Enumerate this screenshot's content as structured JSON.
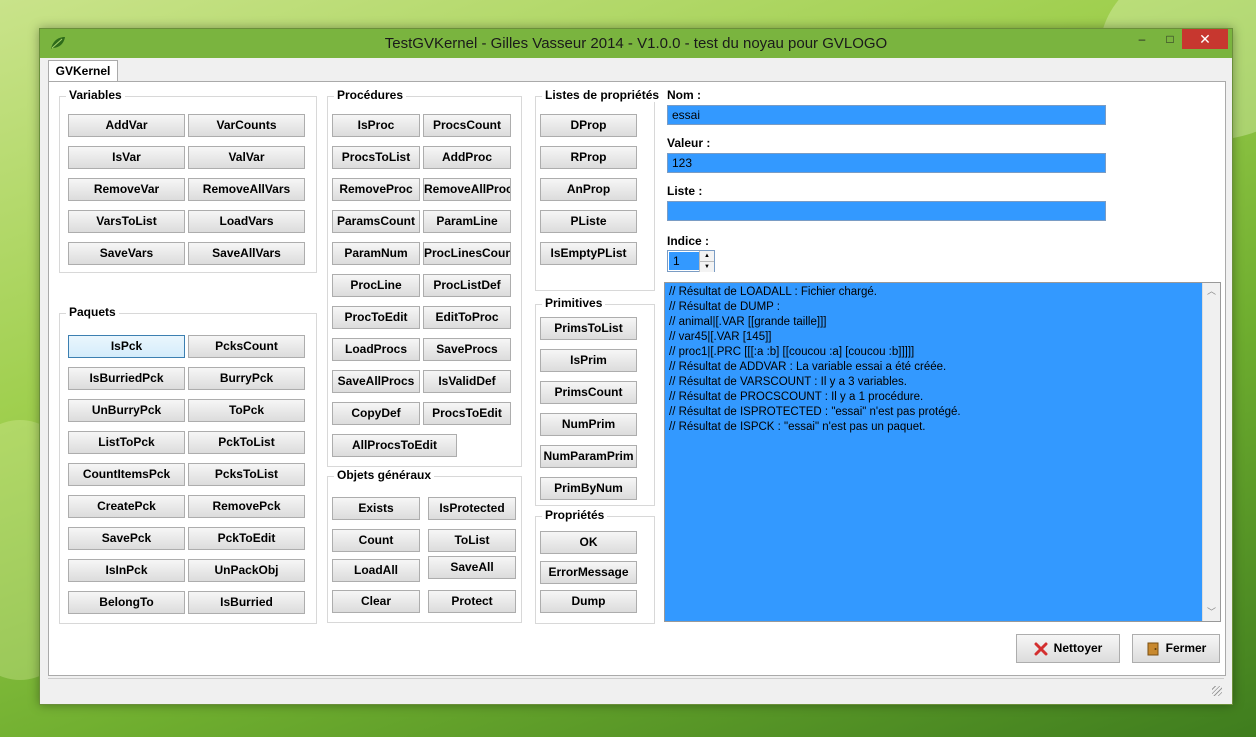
{
  "window": {
    "title": "TestGVKernel - Gilles Vasseur 2014 -  V1.0.0 - test du noyau pour GVLOGO",
    "minimize": "–",
    "maximize": "□",
    "close": "✕"
  },
  "tab": {
    "label": "GVKernel"
  },
  "variables": {
    "title": "Variables",
    "buttons": [
      "AddVar",
      "VarCounts",
      "IsVar",
      "ValVar",
      "RemoveVar",
      "RemoveAllVars",
      "VarsToList",
      "LoadVars",
      "SaveVars",
      "SaveAllVars"
    ]
  },
  "paquets": {
    "title": "Paquets",
    "buttons": [
      "IsPck",
      "PcksCount",
      "IsBurriedPck",
      "BurryPck",
      "UnBurryPck",
      "ToPck",
      "ListToPck",
      "PckToList",
      "CountItemsPck",
      "PcksToList",
      "CreatePck",
      "RemovePck",
      "SavePck",
      "PckToEdit",
      "IsInPck",
      "UnPackObj",
      "BelongTo",
      "IsBurried"
    ]
  },
  "procedures": {
    "title": "Procédures",
    "buttons": [
      "IsProc",
      "ProcsCount",
      "ProcsToList",
      "AddProc",
      "RemoveProc",
      "RemoveAllProcs",
      "ParamsCount",
      "ParamLine",
      "ParamNum",
      "ProcLinesCount",
      "ProcLine",
      "ProcListDef",
      "ProcToEdit",
      "EditToProc",
      "LoadProcs",
      "SaveProcs",
      "SaveAllProcs",
      "IsValidDef",
      "CopyDef",
      "ProcsToEdit",
      "AllProcsToEdit"
    ]
  },
  "objets": {
    "title": "Objets généraux",
    "buttons": [
      "Exists",
      "IsProtected",
      "Count",
      "ToList",
      "LoadAll",
      "SaveAll",
      "Clear",
      "Protect"
    ]
  },
  "listes": {
    "title": "Listes de propriétés",
    "buttons": [
      "DProp",
      "RProp",
      "AnProp",
      "PListe",
      "IsEmptyPList"
    ]
  },
  "primitives": {
    "title": "Primitives",
    "buttons": [
      "PrimsToList",
      "IsPrim",
      "PrimsCount",
      "NumPrim",
      "NumParamPrim",
      "PrimByNum"
    ]
  },
  "proprietes": {
    "title": "Propriétés",
    "buttons": [
      "OK",
      "ErrorMessage",
      "Dump"
    ]
  },
  "form": {
    "nom_label": "Nom :",
    "nom_value": "essai",
    "valeur_label": "Valeur :",
    "valeur_value": "123",
    "liste_label": "Liste :",
    "liste_value": "",
    "indice_label": "Indice :",
    "indice_value": "1"
  },
  "memo": {
    "lines": [
      "// Résultat de LOADALL : Fichier chargé.",
      "// Résultat de DUMP :",
      "// animal|[.VAR [[grande taille]]]",
      "// var45|[.VAR [145]]",
      "// proc1|[.PRC [[[:a :b] [[coucou :a] [coucou :b]]]]]",
      "// Résultat de ADDVAR : La variable essai a été créée.",
      "// Résultat de VARSCOUNT : Il y a 3 variables.",
      "// Résultat de PROCSCOUNT : Il y a 1 procédure.",
      "// Résultat de ISPROTECTED : \"essai\" n'est pas protégé.",
      "// Résultat de ISPCK : \"essai\" n'est pas un paquet."
    ]
  },
  "actions": {
    "nettoyer": "Nettoyer",
    "fermer": "Fermer"
  },
  "colors": {
    "accent": "#3399ff",
    "titlebar": "#7ab43f",
    "close": "#c7372f"
  }
}
